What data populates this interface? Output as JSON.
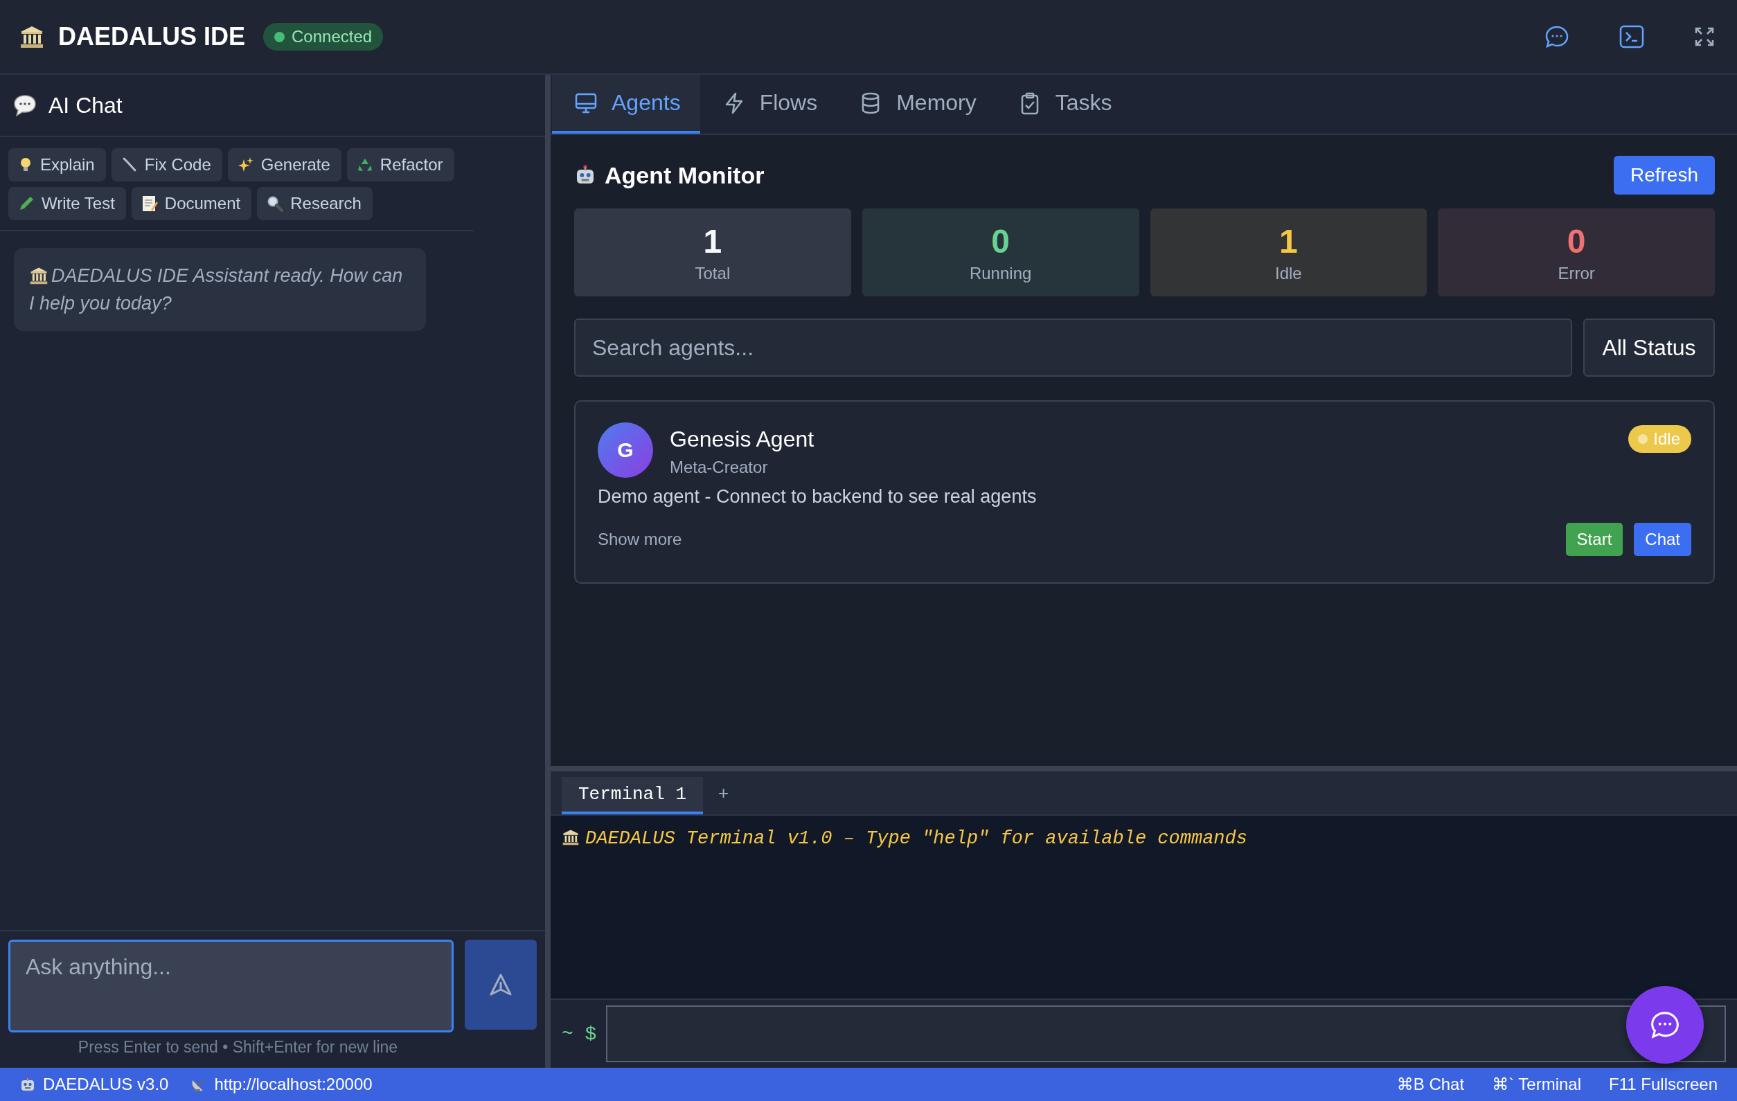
{
  "header": {
    "title": "DAEDALUS IDE",
    "status": {
      "label": "Connected",
      "color": "#48bb78"
    }
  },
  "chat": {
    "title": "AI Chat",
    "actions": [
      "Explain",
      "Fix Code",
      "Generate",
      "Refactor",
      "Write Test",
      "Document",
      "Research"
    ],
    "messages": [
      {
        "text": "DAEDALUS IDE Assistant ready. How can I help you today?"
      }
    ],
    "input": {
      "placeholder": "Ask anything...",
      "focused": true
    },
    "hint": "Press Enter to send • Shift+Enter for new line"
  },
  "tabs": [
    {
      "label": "Agents",
      "selected": true
    },
    {
      "label": "Flows",
      "selected": false
    },
    {
      "label": "Memory",
      "selected": false
    },
    {
      "label": "Tasks",
      "selected": false
    }
  ],
  "monitor": {
    "title": "Agent Monitor",
    "refresh": "Refresh",
    "stats": [
      {
        "value": "1",
        "label": "Total",
        "color": "#f7fafc"
      },
      {
        "value": "0",
        "label": "Running",
        "color": "#68d391"
      },
      {
        "value": "1",
        "label": "Idle",
        "color": "#f6c744"
      },
      {
        "value": "0",
        "label": "Error",
        "color": "#f07171"
      }
    ],
    "search": {
      "placeholder": "Search agents..."
    },
    "filter": "All Status",
    "agents": [
      {
        "initial": "G",
        "name": "Genesis Agent",
        "role": "Meta-Creator",
        "description": "Demo agent - Connect to backend to see real agents",
        "status": "Idle",
        "color": "#ecc94b",
        "show_more": "Show more",
        "buttons": [
          "Start",
          "Chat"
        ]
      }
    ]
  },
  "terminal": {
    "tabs": [
      {
        "label": "Terminal 1",
        "selected": true
      }
    ],
    "add": "+",
    "lines": [
      "DAEDALUS Terminal v1.0 – Type \"help\" for available commands"
    ],
    "prompt": "~ $"
  },
  "status_bar": {
    "left": [
      "DAEDALUS v3.0",
      "http://localhost:20000"
    ],
    "right": [
      "⌘B Chat",
      "⌘` Terminal",
      "F11 Fullscreen"
    ]
  }
}
